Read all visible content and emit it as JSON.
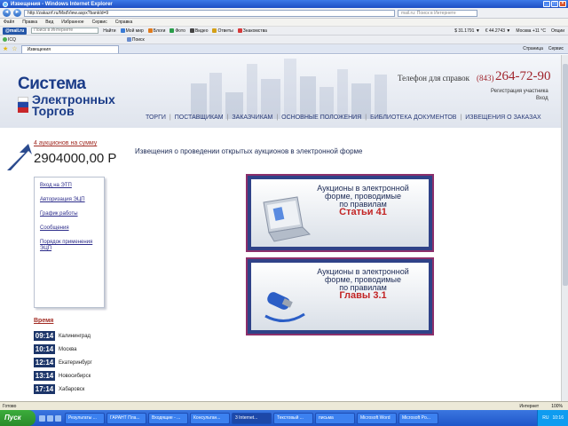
{
  "window": {
    "title": "Извещения - Windows Internet Explorer",
    "url": "http://zakazrf.ru/MsdView.aspx?bankId=9",
    "search_placeholder": "mail.ru: Поиск в Интернете"
  },
  "menu": [
    "Файл",
    "Правка",
    "Вид",
    "Избранное",
    "Сервис",
    "Справка"
  ],
  "toolbar1": {
    "brand": "@mail.ru",
    "search_placeholder": "Поиск в Интернете",
    "find": "Найти",
    "items": [
      "Мой мир",
      "Блоги",
      "Фото",
      "Видео",
      "Ответы",
      "Знакомства"
    ],
    "right": [
      "$ 31.1791 ▼",
      "€ 44.2743 ▼",
      "Москва +11 °C",
      "Опции"
    ]
  },
  "toolbar2": {
    "left": "ICQ",
    "search_label": "Поиск"
  },
  "tabs": {
    "active_label": "Извещения",
    "tools": [
      "Страница",
      "Сервис"
    ]
  },
  "site": {
    "logo_line1": "Система",
    "logo_line2": "Электронных",
    "logo_line3": "Торгов",
    "phone_label": "Телефон для справок",
    "phone_code": "(843)",
    "phone_number": "264-72-90",
    "register_link": "Регистрация участника",
    "login_link": "Вход",
    "nav": [
      "ТОРГИ",
      "ПОСТАВЩИКАМ",
      "ЗАКАЗЧИКАМ",
      "ОСНОВНЫЕ ПОЛОЖЕНИЯ",
      "БИБЛИОТЕКА ДОКУМЕНТОВ",
      "ИЗВЕЩЕНИЯ О ЗАКАЗАХ"
    ]
  },
  "left": {
    "auction_link": "4 аукционов на сумму",
    "auction_sum": "2904000,00 Р",
    "side_links": [
      "Вход на ЭТП",
      "Авторизация ЭЦП",
      "График работы",
      "Сообщения",
      "Порядок применения ЭЦП"
    ],
    "time_title": "Время",
    "times": [
      {
        "time": "09:14",
        "city": "Калининград"
      },
      {
        "time": "10:14",
        "city": "Москва"
      },
      {
        "time": "12:14",
        "city": "Екатеринбург"
      },
      {
        "time": "13:14",
        "city": "Новосибирск"
      },
      {
        "time": "17:14",
        "city": "Хабаровск"
      }
    ]
  },
  "main": {
    "heading": "Извещения о проведении открытых аукционов в электронной форме",
    "banners": [
      {
        "line1": "Аукционы в электронной",
        "line2": "форме, проводимые",
        "line3": "по правилам",
        "highlight": "Статьи 41"
      },
      {
        "line1": "Аукционы в электронной",
        "line2": "форме, проводимые",
        "line3": "по правилам",
        "highlight": "Главы 3.1"
      }
    ]
  },
  "status": {
    "left": "Готово",
    "zone": "Интернет",
    "zoom": "100%"
  },
  "taskbar": {
    "start": "Пуск",
    "tasks": [
      "Результаты ...",
      "ГАРАНТ Пла...",
      "Входящие - ...",
      "Консультан...",
      "3 Internet...",
      "Текстовый ...",
      "письма",
      "Microsoft Word",
      "Microsoft Po..."
    ],
    "lang": "RU",
    "clock": "10:16"
  },
  "colors": {
    "accent": "#1b3c88",
    "red": "#a0242c",
    "banner_bg": "#2f4288",
    "banner_border": "#8c2f6b",
    "time_box": "#1c3569"
  }
}
